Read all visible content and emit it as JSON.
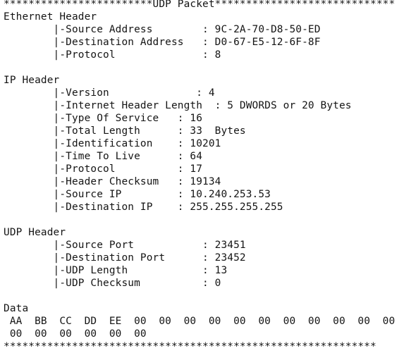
{
  "lines": [
    "************************UDP Packet*****************************",
    "Ethernet Header",
    "        |-Source Address        : 9C-2A-70-D8-50-ED",
    "        |-Destination Address   : D0-67-E5-12-6F-8F",
    "        |-Protocol              : 8",
    "",
    "IP Header",
    "        |-Version              : 4",
    "        |-Internet Header Length  : 5 DWORDS or 20 Bytes",
    "        |-Type Of Service   : 16",
    "        |-Total Length      : 33  Bytes",
    "        |-Identification    : 10201",
    "        |-Time To Live      : 64",
    "        |-Protocol          : 17",
    "        |-Header Checksum   : 19134",
    "        |-Source IP         : 10.240.253.53",
    "        |-Destination IP    : 255.255.255.255",
    "",
    "UDP Header",
    "        |-Source Port           : 23451",
    "        |-Destination Port      : 23452",
    "        |-UDP Length            : 13",
    "        |-UDP Checksum          : 0",
    "",
    "Data",
    " AA  BB  CC  DD  EE  00  00  00  00  00  00  00  00  00  00  00",
    " 00  00  00  00  00  00",
    "************************************************************"
  ]
}
